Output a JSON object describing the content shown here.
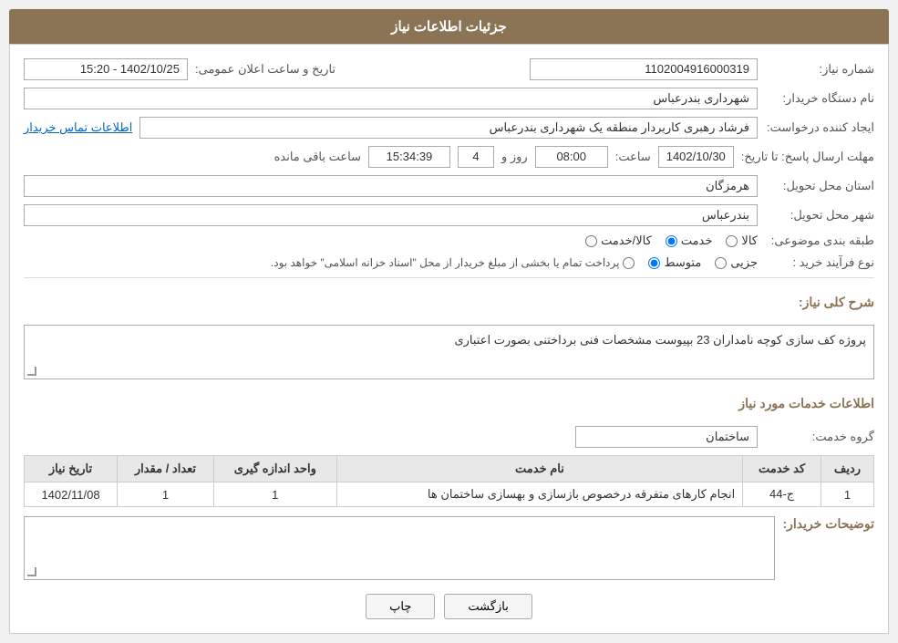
{
  "header": {
    "title": "جزئیات اطلاعات نیاز"
  },
  "info": {
    "need_number_label": "شماره نیاز:",
    "need_number_value": "1102004916000319",
    "buyer_org_label": "نام دستگاه خریدار:",
    "buyer_org_value": "شهرداری بندرعباس",
    "announce_datetime_label": "تاریخ و ساعت اعلان عمومی:",
    "announce_datetime_value": "1402/10/25 - 15:20",
    "creator_label": "ایجاد کننده درخواست:",
    "creator_value": "فرشاد رهبری کاربردار منطقه یک شهرداری بندرعباس",
    "contact_link": "اطلاعات تماس خریدار",
    "deadline_label": "مهلت ارسال پاسخ: تا تاریخ:",
    "deadline_date": "1402/10/30",
    "deadline_time_label": "ساعت:",
    "deadline_time": "08:00",
    "deadline_days_label": "روز و",
    "deadline_days": "4",
    "deadline_remaining_label": "ساعت باقی مانده",
    "deadline_remaining": "15:34:39",
    "province_label": "استان محل تحویل:",
    "province_value": "هرمزگان",
    "city_label": "شهر محل تحویل:",
    "city_value": "بندرعباس",
    "category_label": "طبقه بندی موضوعی:",
    "category_options": [
      {
        "id": "kala",
        "label": "کالا"
      },
      {
        "id": "khedmat",
        "label": "خدمت"
      },
      {
        "id": "kala_khedmat",
        "label": "کالا/خدمت"
      }
    ],
    "category_selected": "khedmat",
    "purchase_type_label": "نوع فرآیند خرید :",
    "purchase_type_options": [
      {
        "id": "jozi",
        "label": "جزیی"
      },
      {
        "id": "motaset",
        "label": "متوسط"
      },
      {
        "id": "other",
        "label": "پرداخت تمام یا بخشی از مبلغ خریدار از محل \"اسناد خزانه اسلامی\" خواهد بود."
      }
    ],
    "purchase_type_selected": "motaset"
  },
  "description": {
    "section_title": "شرح کلی نیاز:",
    "text": "پروژه کف سازی کوچه نامداران 23 بپیوست مشخصات فنی برداختنی بصورت اعتباری"
  },
  "services_section": {
    "title": "اطلاعات خدمات مورد نیاز",
    "service_group_label": "گروه خدمت:",
    "service_group_value": "ساختمان",
    "table": {
      "columns": [
        "ردیف",
        "کد خدمت",
        "نام خدمت",
        "واحد اندازه گیری",
        "تعداد / مقدار",
        "تاریخ نیاز"
      ],
      "rows": [
        {
          "row_num": "1",
          "service_code": "ج-44",
          "service_name": "انجام کارهای متفرقه درخصوص بازسازی و بهسازی ساختمان ها",
          "unit": "1",
          "quantity": "1",
          "date": "1402/11/08"
        }
      ]
    }
  },
  "buyer_notes": {
    "label": "توضیحات خریدار:",
    "text": ""
  },
  "buttons": {
    "back_label": "بازگشت",
    "print_label": "چاپ"
  }
}
